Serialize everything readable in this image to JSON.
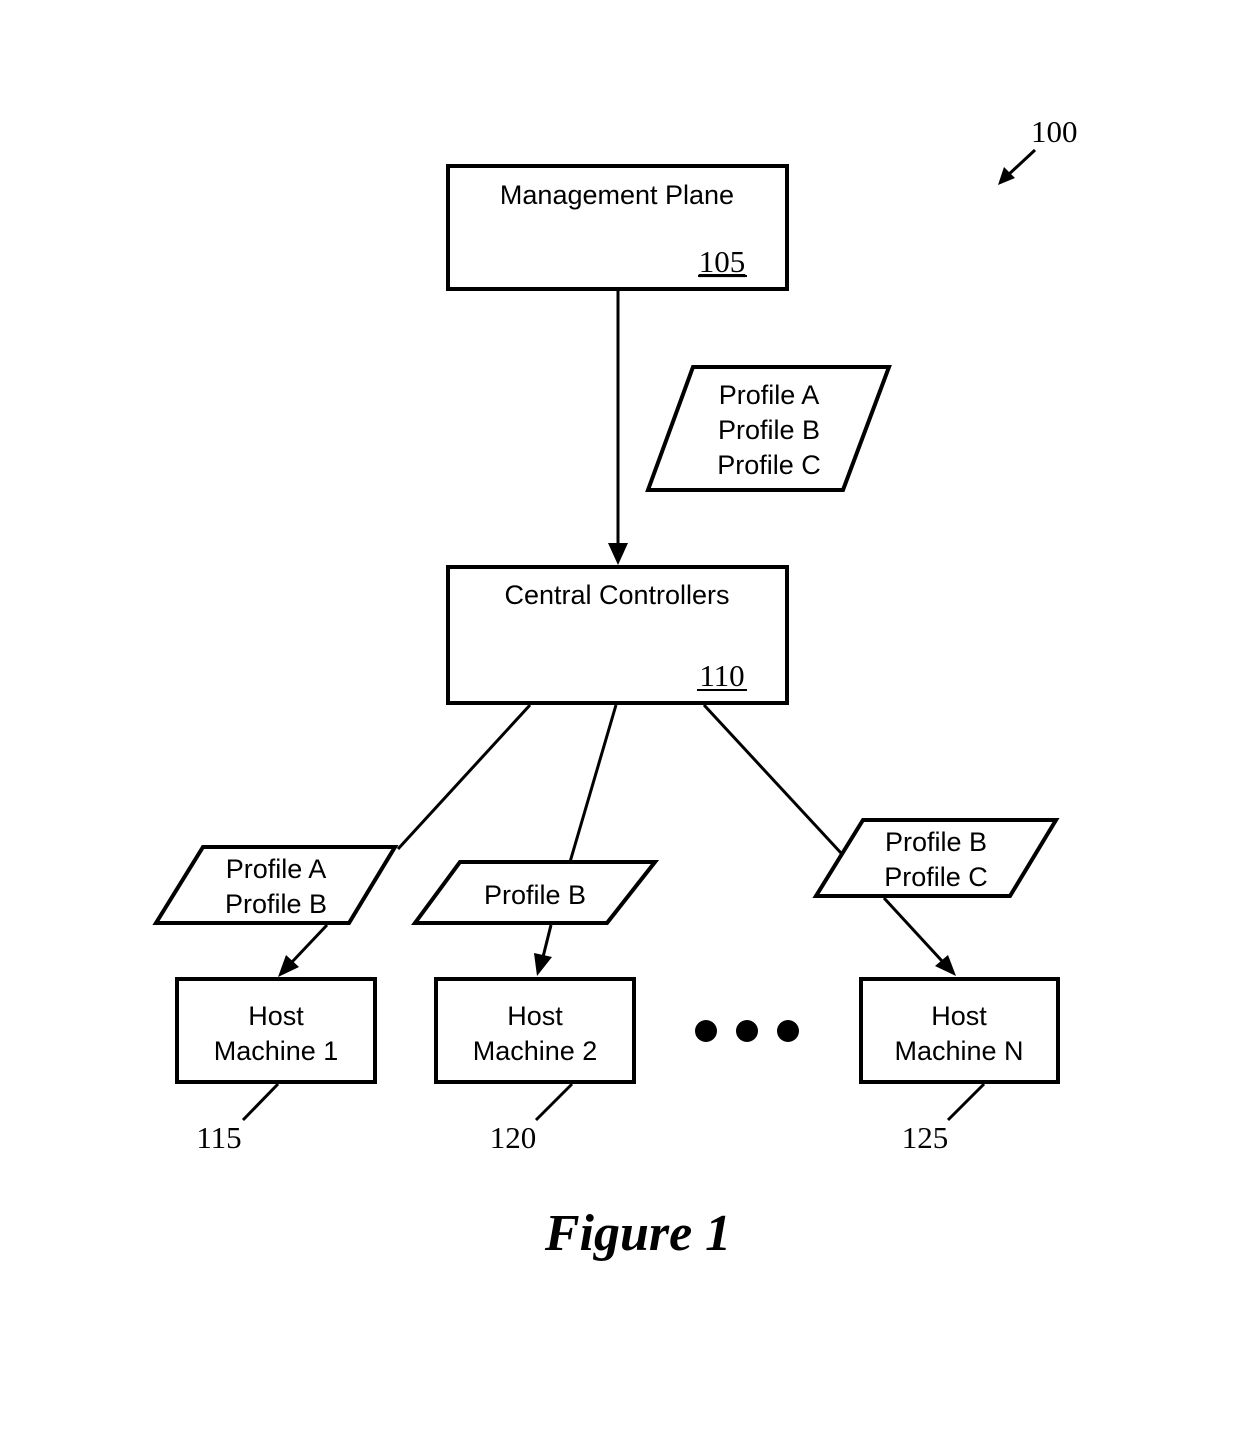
{
  "figure": {
    "reference": "100",
    "caption": "Figure 1"
  },
  "nodes": {
    "management_plane": {
      "title": "Management Plane",
      "ref": "105"
    },
    "central_controllers": {
      "title": "Central Controllers",
      "ref": "110"
    },
    "hosts": [
      {
        "line1": "Host",
        "line2": "Machine 1",
        "ref": "115"
      },
      {
        "line1": "Host",
        "line2": "Machine 2",
        "ref": "120"
      },
      {
        "line1": "Host",
        "line2": "Machine N",
        "ref": "125"
      }
    ]
  },
  "profiles": {
    "to_controllers": [
      "Profile A",
      "Profile B",
      "Profile C"
    ],
    "to_host1": [
      "Profile A",
      "Profile B"
    ],
    "to_host2": [
      "Profile B"
    ],
    "to_hostN": [
      "Profile B",
      "Profile C"
    ]
  },
  "ellipsis": "more host machines"
}
